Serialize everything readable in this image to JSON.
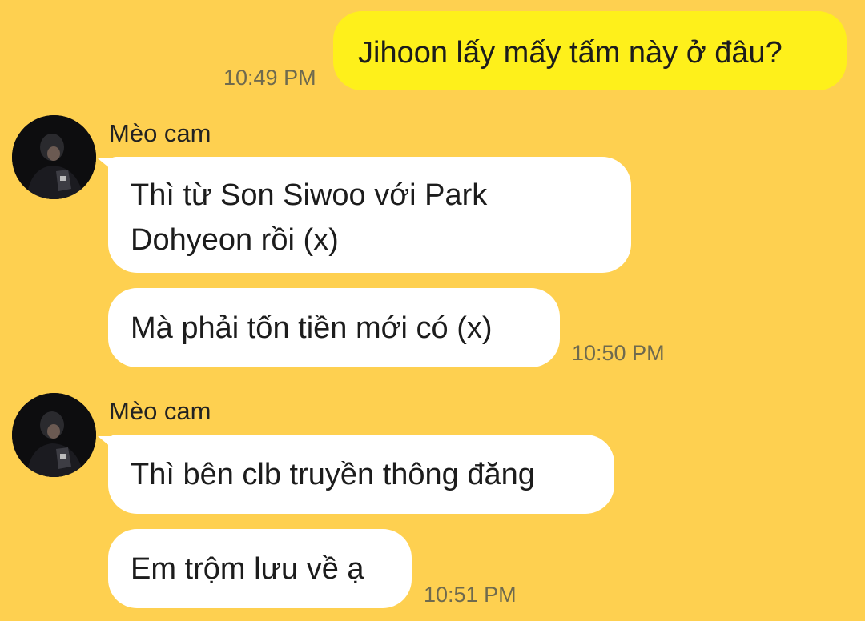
{
  "colors": {
    "background": "#fed050",
    "outgoing_bubble": "#fef01b",
    "incoming_bubble": "#ffffff"
  },
  "messages": [
    {
      "direction": "out",
      "text": "Jihoon lấy mấy tấm này ở đâu?",
      "time": "10:49 PM"
    },
    {
      "direction": "in",
      "sender": "Mèo cam",
      "avatar_icon": "profile-photo-avatar",
      "text_lines": [
        "Thì từ Son Siwoo với Park",
        "Dohyeon rồi (x)"
      ]
    },
    {
      "direction": "in",
      "text": "Mà phải tốn tiền mới có (x)",
      "time": "10:50 PM"
    },
    {
      "direction": "in",
      "sender": "Mèo cam",
      "avatar_icon": "profile-photo-avatar",
      "text": "Thì bên clb truyền thông đăng"
    },
    {
      "direction": "in",
      "text": "Em trộm lưu về ạ",
      "time": "10:51 PM"
    }
  ]
}
